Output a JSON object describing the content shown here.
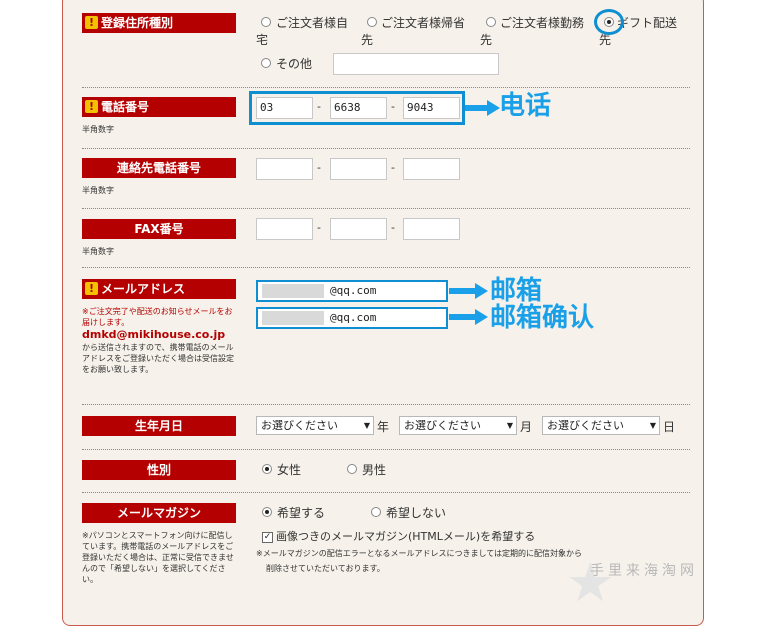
{
  "address_type": {
    "label": "登録住所種別",
    "required_mark": "!",
    "options": [
      {
        "line1": "ご注文者様自",
        "line2": "宅",
        "selected": false
      },
      {
        "line1": "ご注文者様帰省",
        "line2": "先",
        "selected": false
      },
      {
        "line1": "ご注文者様勤務",
        "line2": "先",
        "selected": false
      },
      {
        "line1": "ギフト配送",
        "line2": "先",
        "selected": true
      }
    ],
    "other_label": "その他",
    "other_value": ""
  },
  "phone": {
    "label": "電話番号",
    "required_mark": "!",
    "note": "半角数字",
    "parts": [
      "03",
      "6638",
      "9043"
    ],
    "separator": "-",
    "annotation": "电话"
  },
  "contact_phone": {
    "label": "連絡先電話番号",
    "note": "半角数字",
    "parts": [
      "",
      "",
      ""
    ],
    "separator": "-"
  },
  "fax": {
    "label": "FAX番号",
    "note": "半角数字",
    "parts": [
      "",
      "",
      ""
    ],
    "separator": "-"
  },
  "email": {
    "label": "メールアドレス",
    "required_mark": "!",
    "note_prefix": "※ご注文完了や配送のお知らせメールをお届けします。",
    "note_email": "dmkd@mikihouse.co.jp",
    "note_suffix": "から送信されますので、携帯電話のメールアドレスをご登録いただく場合は受信設定をお願い致します。",
    "value": "@qq.com",
    "confirm_value": "@qq.com",
    "annotation": "邮箱",
    "confirm_annotation": "邮箱确认"
  },
  "birthday": {
    "label": "生年月日",
    "placeholder": "お選びください",
    "year_unit": "年",
    "month_unit": "月",
    "day_unit": "日"
  },
  "gender": {
    "label": "性別",
    "options": [
      {
        "text": "女性",
        "selected": true
      },
      {
        "text": "男性",
        "selected": false
      }
    ]
  },
  "magazine": {
    "label": "メールマガジン",
    "options": [
      {
        "text": "希望する",
        "selected": true
      },
      {
        "text": "希望しない",
        "selected": false
      }
    ],
    "html_checkbox_label": "画像つきのメールマガジン(HTMLメール)を希望する",
    "html_checked": true,
    "left_note": "※パソコンとスマートフォン向けに配信しています。携帯電話のメールアドレスをご登録いただく場合は、正常に受信できませんので「希望しない」を選択してください。",
    "error_note_1": "※メールマガジンの配信エラーとなるメールアドレスにつきましては定期的に配信対象から",
    "error_note_2": "削除させていただいております。"
  },
  "watermark": "手里来海淘网",
  "colors": {
    "label_bg": "#b40000",
    "annotation": "#1aa0e8",
    "panel_bg": "#f6f1ea"
  }
}
